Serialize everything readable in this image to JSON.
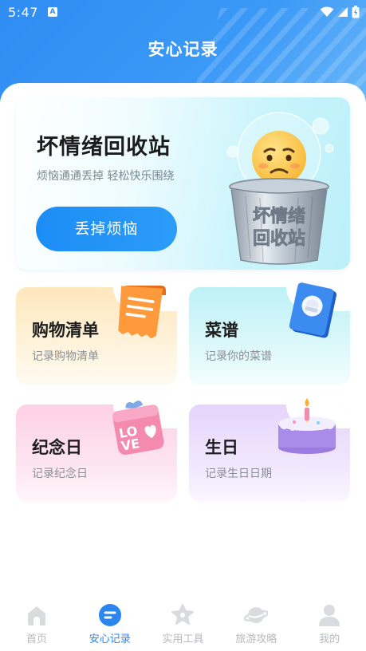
{
  "status_bar": {
    "time": "5:47",
    "notification_badge": "A"
  },
  "header": {
    "title": "安心记录"
  },
  "hero": {
    "title": "坏情绪回收站",
    "subtitle": "烦恼通通丢掉 轻松快乐围绕",
    "button_label": "丢掉烦恼",
    "art_label_line1": "坏情绪",
    "art_label_line2": "回收站"
  },
  "cards": [
    {
      "title": "购物清单",
      "subtitle": "记录购物清单"
    },
    {
      "title": "菜谱",
      "subtitle": "记录你的菜谱"
    },
    {
      "title": "纪念日",
      "subtitle": "记录纪念日"
    },
    {
      "title": "生日",
      "subtitle": "记录生日日期"
    }
  ],
  "gift_box_text": {
    "l1": "LO",
    "l2": "VE"
  },
  "bottom_nav": [
    {
      "label": "首页",
      "icon": "home-icon",
      "active": false
    },
    {
      "label": "安心记录",
      "icon": "note-icon",
      "active": true
    },
    {
      "label": "实用工具",
      "icon": "star-tool-icon",
      "active": false
    },
    {
      "label": "旅游攻略",
      "icon": "planet-icon",
      "active": false
    },
    {
      "label": "我的",
      "icon": "person-icon",
      "active": false
    }
  ],
  "colors": {
    "header_blue": "#3a98f7",
    "button_blue": "#1c8df5",
    "nav_active": "#2b86f0",
    "nav_inactive": "#b6b9bd"
  }
}
